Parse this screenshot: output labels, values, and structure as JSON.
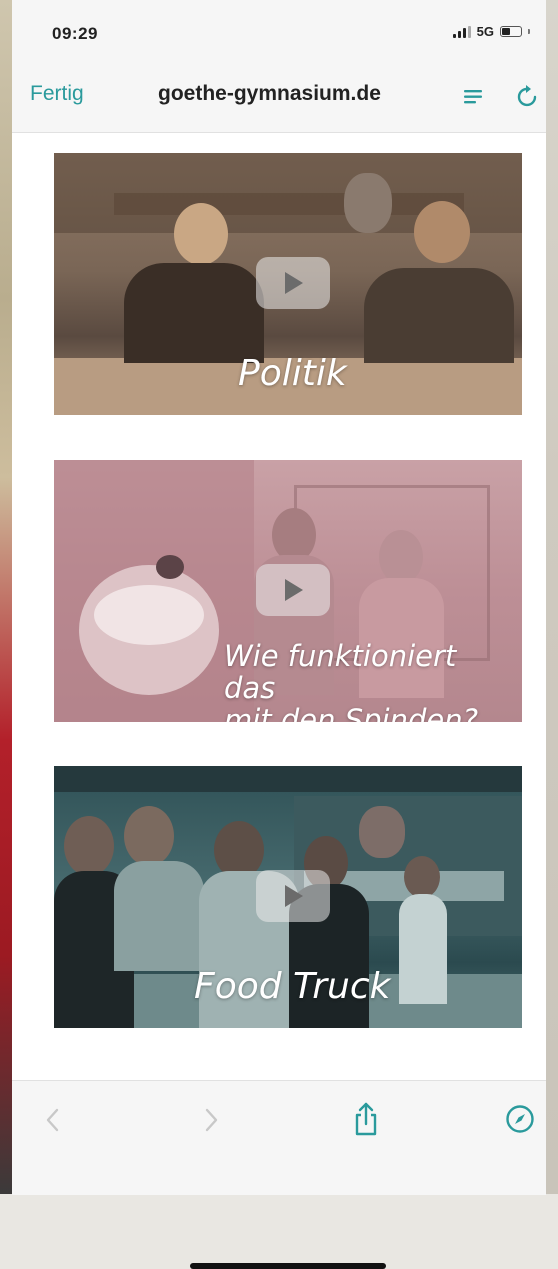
{
  "status_bar": {
    "time": "09:29",
    "network": "5G"
  },
  "nav_bar": {
    "done_label": "Fertig",
    "url": "goethe-gymnasium.de"
  },
  "videos": [
    {
      "caption": "Politik"
    },
    {
      "caption_line1": "Wie funktioniert das",
      "caption_line2": "mit den Spinden?"
    },
    {
      "caption": "Food Truck"
    }
  ],
  "colors": {
    "accent": "#2a9a9c",
    "toolbar_bg": "#f6f6f6"
  },
  "icons": {
    "reader": "reader-mode-icon",
    "reload": "reload-icon",
    "back": "chevron-left-icon",
    "forward": "chevron-right-icon",
    "share": "share-icon",
    "safari": "compass-icon"
  }
}
